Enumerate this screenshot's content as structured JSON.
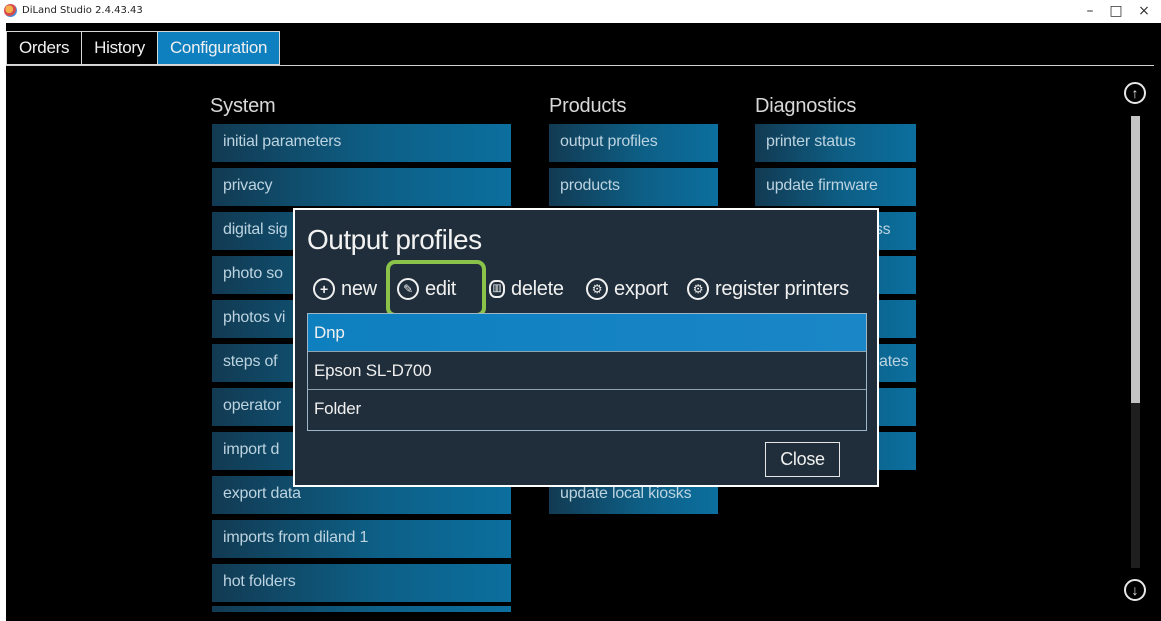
{
  "window": {
    "title": "DiLand Studio 2.4.43.43",
    "controls": {
      "minimize": "–",
      "maximize": "□",
      "close": "×"
    }
  },
  "tabs": [
    {
      "label": "Orders",
      "active": false
    },
    {
      "label": "History",
      "active": false
    },
    {
      "label": "Configuration",
      "active": true
    }
  ],
  "sections": {
    "system": {
      "title": "System",
      "items": [
        "initial parameters",
        "privacy",
        "digital sig",
        "photo so",
        "photos vi",
        "steps of",
        "operator",
        "import d",
        "export data",
        "imports from diland 1",
        "hot folders"
      ]
    },
    "products": {
      "title": "Products",
      "items": [
        "output profiles",
        "products",
        "update local kiosks"
      ]
    },
    "diagnostics": {
      "title": "Diagnostics",
      "items": [
        "printer status",
        "update firmware",
        "ress",
        "ates"
      ]
    }
  },
  "dialog": {
    "title": "Output profiles",
    "toolbar": {
      "new": "new",
      "edit": "edit",
      "delete": "delete",
      "export": "export",
      "register": "register printers"
    },
    "profiles": [
      {
        "name": "Dnp",
        "selected": true
      },
      {
        "name": "Epson SL-D700",
        "selected": false
      },
      {
        "name": "Folder",
        "selected": false
      }
    ],
    "close_label": "Close"
  },
  "scroll": {
    "up": "↑",
    "down": "↓"
  },
  "colors": {
    "accent": "#0e7fbf",
    "highlight": "#8bc34a",
    "dialog_bg": "#1f2e3a"
  }
}
